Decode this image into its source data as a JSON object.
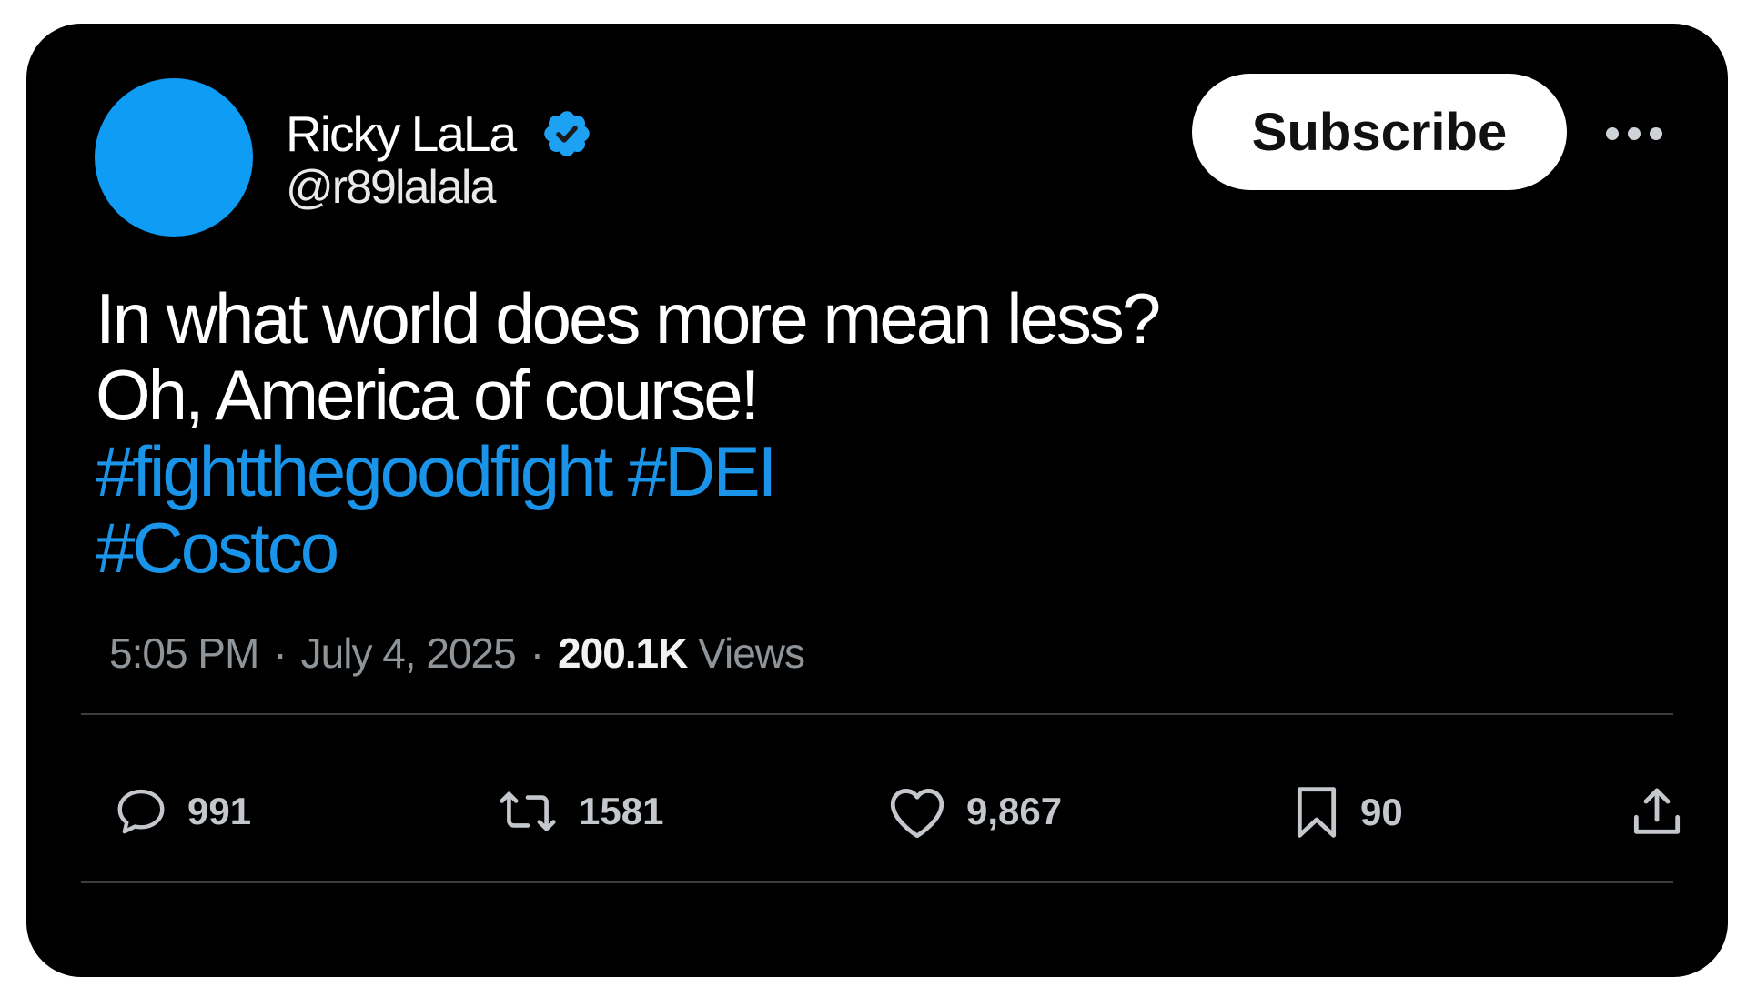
{
  "author": {
    "name": "Ricky LaLa",
    "handle": "@r89lalala",
    "avatar_color": "#0f9cf5",
    "verified_icon": "verified-badge-icon"
  },
  "header": {
    "subscribe_label": "Subscribe",
    "more_icon": "more-icon"
  },
  "post": {
    "lines": [
      "In what world does more mean less?",
      "Oh, America of course!"
    ],
    "hashtag_lines": [
      "#fightthegoodfight #DEI",
      "#Costco"
    ],
    "hashtag_color": "#1a94e8"
  },
  "meta": {
    "time": "5:05 PM",
    "date": "July 4, 2025",
    "views_count": "200.1K",
    "views_label": "Views",
    "separator": "·"
  },
  "actions": {
    "replies": "991",
    "reposts": "1581",
    "likes": "9,867",
    "bookmarks": "90"
  }
}
